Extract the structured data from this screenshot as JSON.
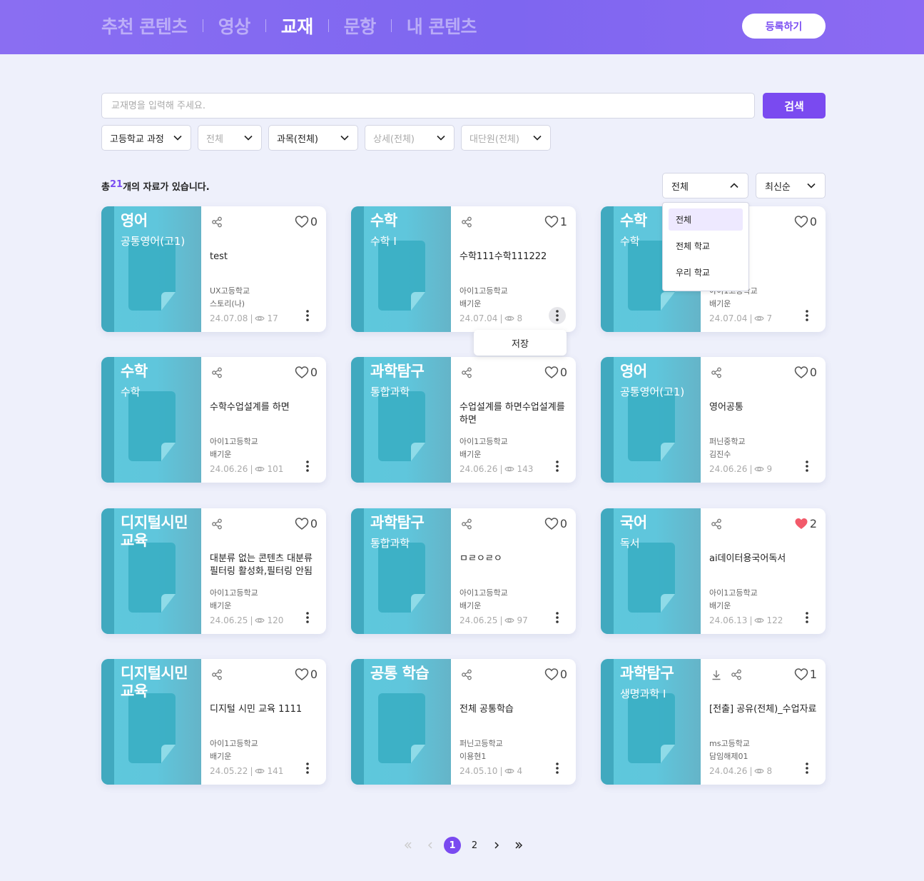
{
  "nav": {
    "items": [
      {
        "label": "추천 콘텐츠",
        "active": false
      },
      {
        "label": "영상",
        "active": false
      },
      {
        "label": "교재",
        "active": true
      },
      {
        "label": "문항",
        "active": false
      },
      {
        "label": "내 콘텐츠",
        "active": false
      }
    ],
    "register_label": "등록하기"
  },
  "search": {
    "placeholder": "교재명을 입력해 주세요.",
    "value": "",
    "button_label": "검색"
  },
  "filters": [
    {
      "value": "고등학교 과정",
      "disabled": false
    },
    {
      "value": "전체",
      "disabled": true
    },
    {
      "value": "과목(전체)",
      "disabled": false
    },
    {
      "value": "상세(전체)",
      "disabled": true
    },
    {
      "value": "대단원(전체)",
      "disabled": true
    }
  ],
  "total": {
    "prefix": "총 ",
    "count": "21",
    "suffix": "개의 자료가 있습니다."
  },
  "scope_select": {
    "value": "전체",
    "options": [
      "전체",
      "전체 학교",
      "우리 학교"
    ]
  },
  "sort_select": {
    "value": "최신순"
  },
  "context_menu": {
    "save_label": "저장"
  },
  "colors": {
    "accent": "#7a4af0",
    "thumb": "#5ec8dc",
    "liked_heart": "#f25a6a"
  },
  "cards": [
    {
      "subject": "영어",
      "course": "공통영어(고1)",
      "title": "test",
      "school": "UX고등학교",
      "author": "스토리(나)",
      "date": "24.07.08",
      "views": "17",
      "likes": "0",
      "liked": false,
      "download": false
    },
    {
      "subject": "수학",
      "course": "수학 I",
      "title": "수학111수학111222",
      "school": "아이1고등학교",
      "author": "배기운",
      "date": "24.07.04",
      "views": "8",
      "likes": "1",
      "liked": false,
      "download": false
    },
    {
      "subject": "수학",
      "course": "수학",
      "title": "",
      "school": "아이1고등학교",
      "author": "배기운",
      "date": "24.07.04",
      "views": "7",
      "likes": "0",
      "liked": false,
      "download": false
    },
    {
      "subject": "수학",
      "course": "수학",
      "title": "수학수업설계를 하면",
      "school": "아이1고등학교",
      "author": "배기운",
      "date": "24.06.26",
      "views": "101",
      "likes": "0",
      "liked": false,
      "download": false
    },
    {
      "subject": "과학탐구",
      "course": "통합과학",
      "title": "수업설계를 하면수업설계를 하면",
      "school": "아이1고등학교",
      "author": "배기운",
      "date": "24.06.26",
      "views": "143",
      "likes": "0",
      "liked": false,
      "download": false
    },
    {
      "subject": "영어",
      "course": "공통영어(고1)",
      "title": "영어공통",
      "school": "퍼닌중학교",
      "author": "김진수",
      "date": "24.06.26",
      "views": "9",
      "likes": "0",
      "liked": false,
      "download": false
    },
    {
      "subject": "디지털시민교육",
      "course": "",
      "title": "대분류 없는 콘텐츠 대분류 필터링 활성화,필터링 안됨",
      "school": "아이1고등학교",
      "author": "배기운",
      "date": "24.06.25",
      "views": "120",
      "likes": "0",
      "liked": false,
      "download": false
    },
    {
      "subject": "과학탐구",
      "course": "통합과학",
      "title": "ㅁㄹㅇㄹㅇ",
      "school": "아이1고등학교",
      "author": "배기운",
      "date": "24.06.25",
      "views": "97",
      "likes": "0",
      "liked": false,
      "download": false
    },
    {
      "subject": "국어",
      "course": "독서",
      "title": "ai데이터용국어독서",
      "school": "아이1고등학교",
      "author": "배기운",
      "date": "24.06.13",
      "views": "122",
      "likes": "2",
      "liked": true,
      "download": false
    },
    {
      "subject": "디지털시민교육",
      "course": "",
      "title": "디지털 시민 교육 1111",
      "school": "아이1고등학교",
      "author": "배기운",
      "date": "24.05.22",
      "views": "141",
      "likes": "0",
      "liked": false,
      "download": false
    },
    {
      "subject": "공통 학습",
      "course": "",
      "title": "전체 공통학습",
      "school": "퍼닌고등학교",
      "author": "이용현1",
      "date": "24.05.10",
      "views": "4",
      "likes": "0",
      "liked": false,
      "download": false
    },
    {
      "subject": "과학탐구",
      "course": "생명과학 I",
      "title": "[전출] 공유(전체)_수업자료",
      "school": "ms고등학교",
      "author": "담임해제01",
      "date": "24.04.26",
      "views": "8",
      "likes": "1",
      "liked": false,
      "download": true
    }
  ],
  "pagination": {
    "pages": [
      "1",
      "2"
    ],
    "current": "1"
  }
}
